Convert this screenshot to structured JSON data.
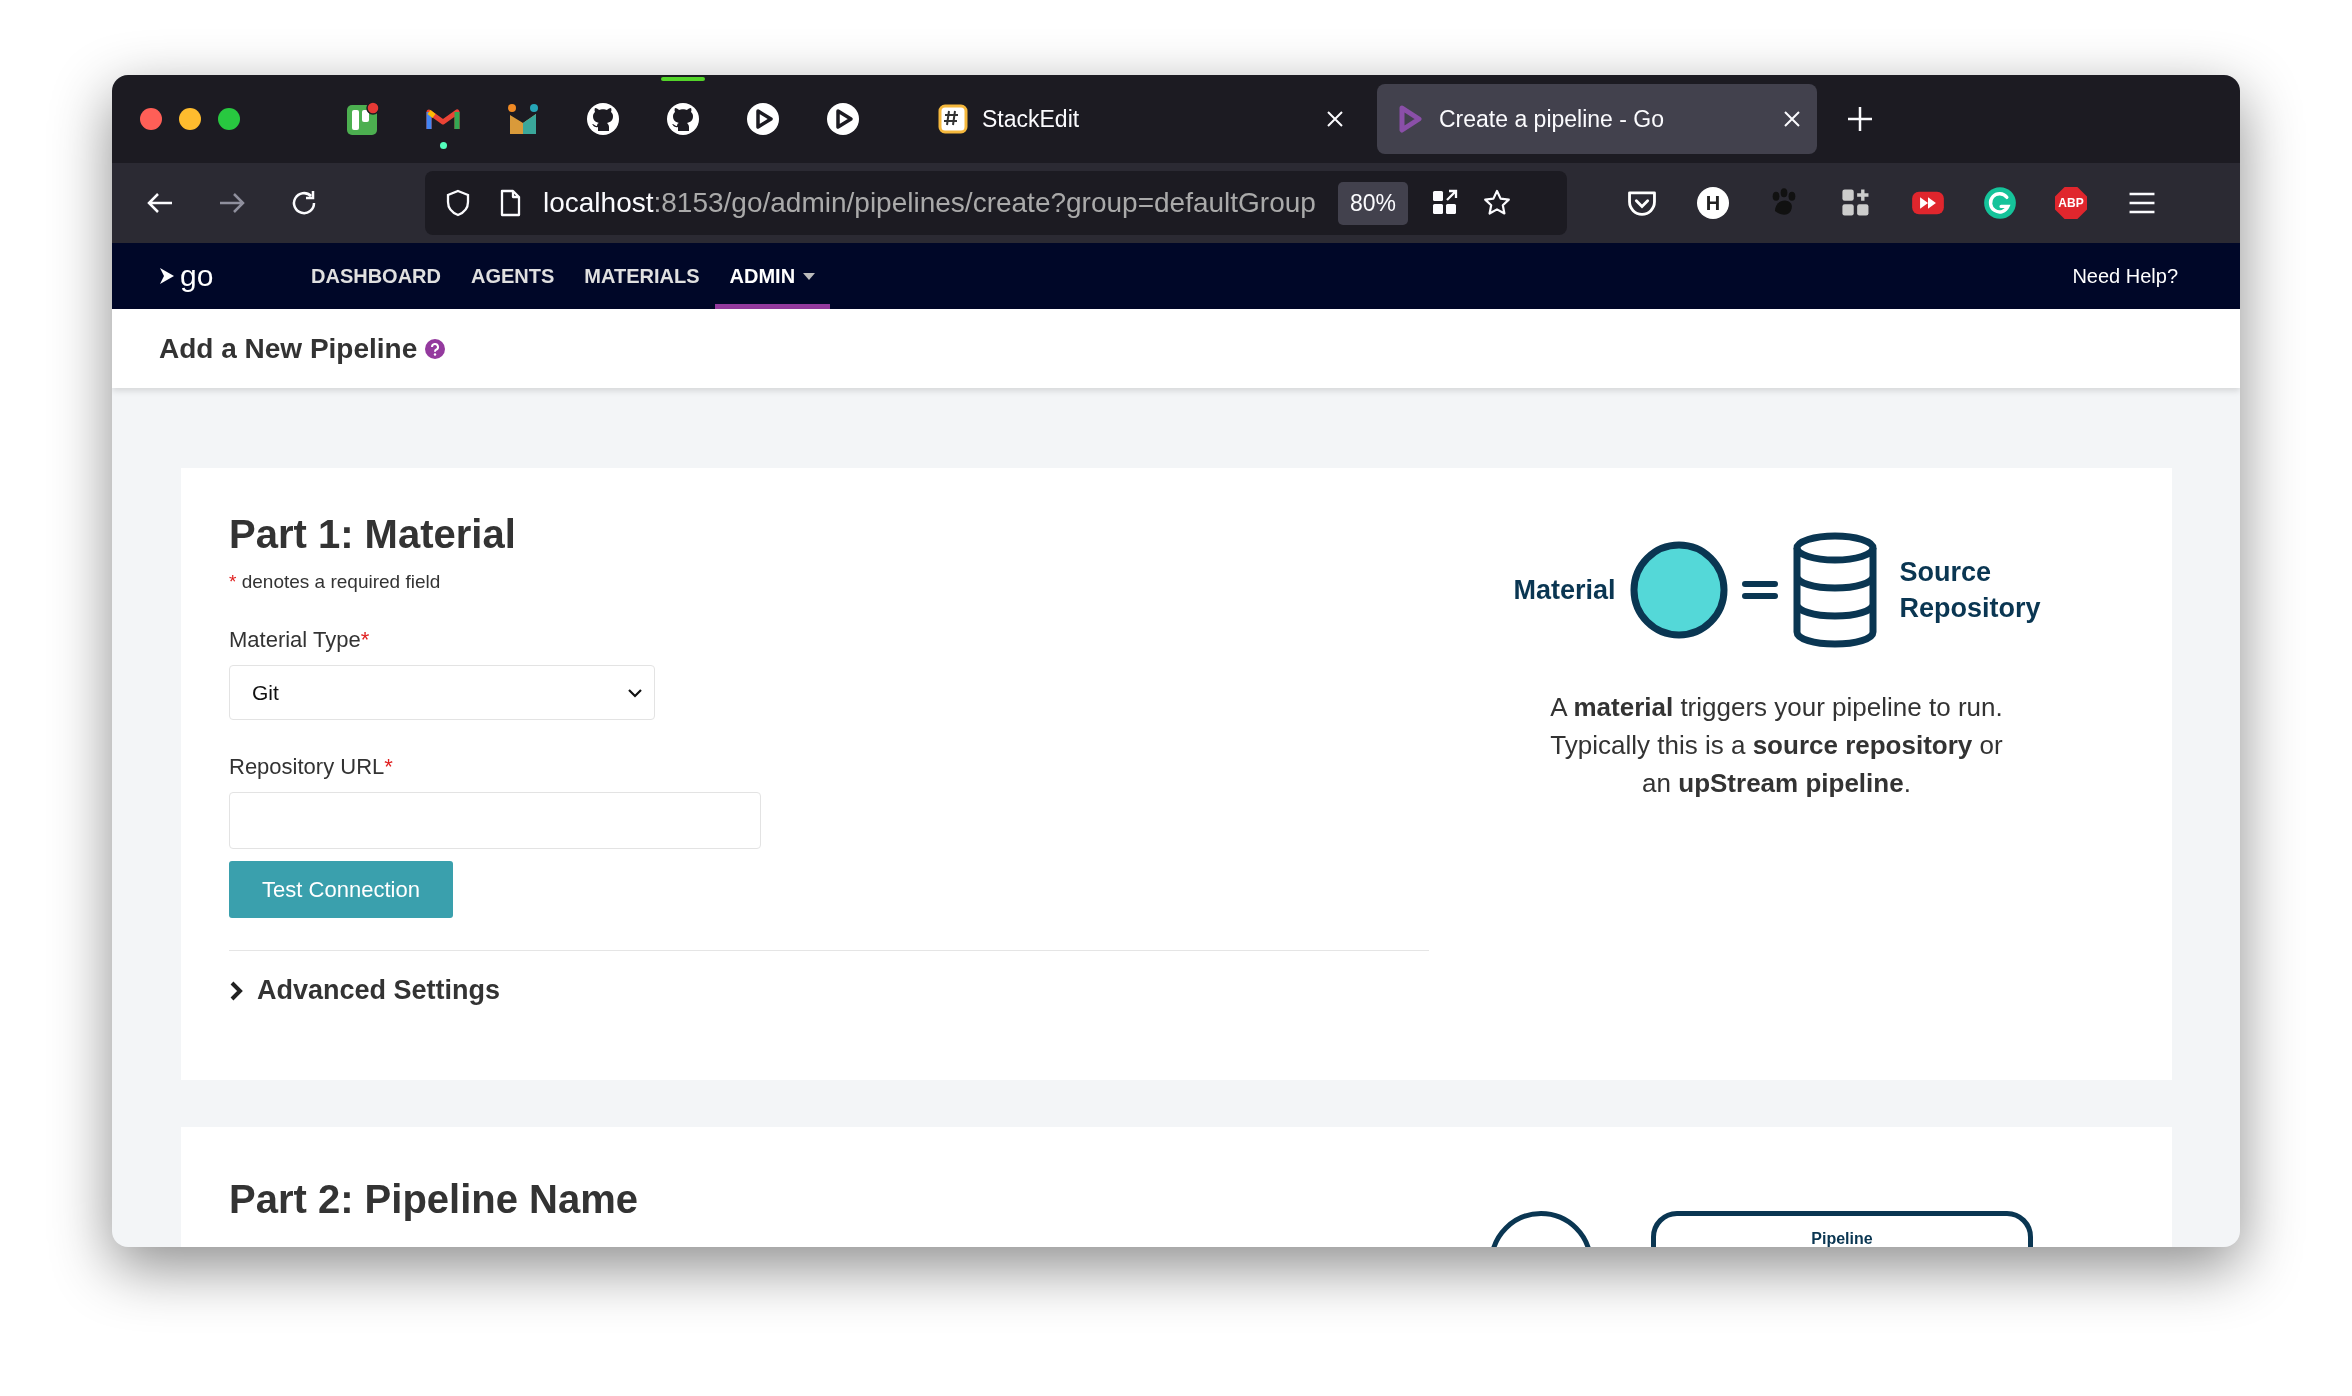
{
  "browser": {
    "pinned_tabs": [
      {
        "kind": "board",
        "dot": false,
        "attention": false
      },
      {
        "kind": "mail",
        "dot": true,
        "attention": false
      },
      {
        "kind": "chart",
        "dot": false,
        "attention": false
      },
      {
        "kind": "cat",
        "dot": false,
        "attention": false
      },
      {
        "kind": "cat",
        "dot": false,
        "attention": true
      },
      {
        "kind": "play",
        "dot": false,
        "attention": false
      },
      {
        "kind": "play",
        "dot": false,
        "attention": false
      }
    ],
    "tabs": [
      {
        "title": "StackEdit",
        "kind": "hash",
        "selected": false
      },
      {
        "title": "Create a pipeline - Go",
        "kind": "play",
        "selected": true
      }
    ],
    "address": {
      "host": "localhost",
      "path": ":8153/go/admin/pipelines/create?group=defaultGroup",
      "zoom": "80%"
    },
    "extensions": [
      {
        "kind": "pocket"
      },
      {
        "kind": "letter",
        "label": "H"
      },
      {
        "kind": "paw"
      },
      {
        "kind": "apps"
      },
      {
        "kind": "video"
      },
      {
        "kind": "refresh"
      },
      {
        "kind": "octagon",
        "label": "ABP"
      }
    ]
  },
  "nav": {
    "logo": "go",
    "items": [
      {
        "label": "DASHBOARD",
        "selected": false,
        "dropdown": false
      },
      {
        "label": "AGENTS",
        "selected": false,
        "dropdown": false
      },
      {
        "label": "MATERIALS",
        "selected": false,
        "dropdown": false
      },
      {
        "label": "ADMIN",
        "selected": true,
        "dropdown": true
      }
    ],
    "help": "Need Help?"
  },
  "page_header": {
    "title": "Add a New Pipeline"
  },
  "parts": [
    {
      "title": "Part 1: Material",
      "required_mark": "*",
      "required_note": "denotes a required field",
      "fields": [
        {
          "kind": "select",
          "label": "Material Type",
          "required_mark": "*",
          "value": "Git"
        },
        {
          "kind": "text",
          "label": "Repository URL",
          "required_mark": "*"
        }
      ],
      "button": "Test Connection",
      "advanced": {
        "label": "Advanced Settings",
        "expanded": false
      },
      "illustration": {
        "kind": "material",
        "left_label": "Material",
        "right_label": "Source Repository",
        "description": "A **material** triggers your pipeline to run. Typically this is a **source repository** or an **upStream pipeline**."
      }
    },
    {
      "title": "Part 2: Pipeline Name",
      "illustration": {
        "kind": "pipeline",
        "box_label": "Pipeline"
      }
    }
  ]
}
